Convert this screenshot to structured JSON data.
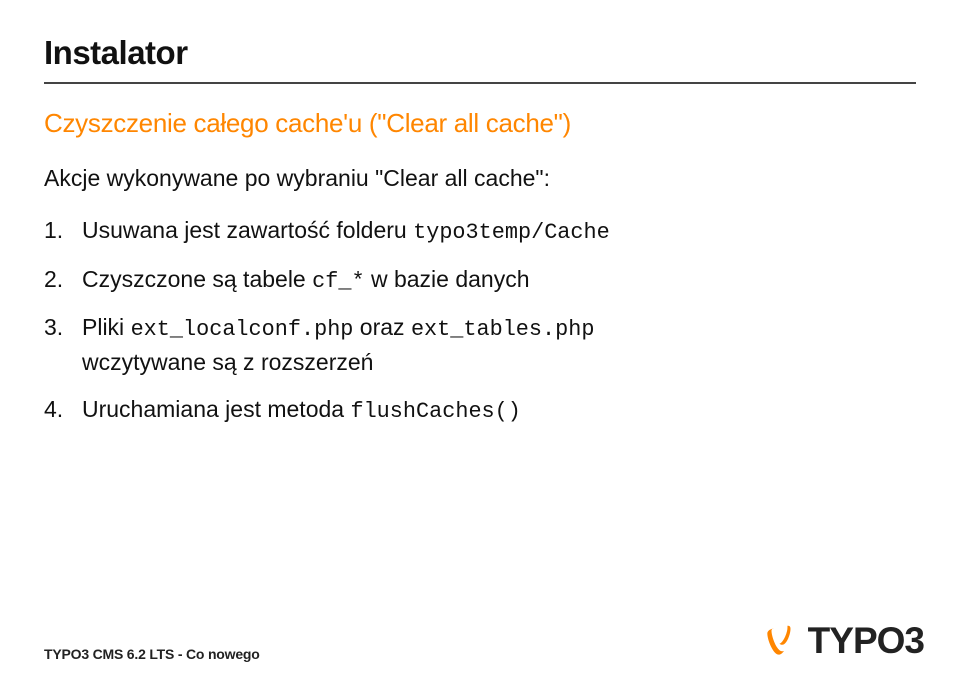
{
  "header": {
    "title": "Instalator"
  },
  "section": {
    "subtitle": "Czyszczenie całego cache'u (\"Clear all cache\")",
    "intro": "Akcje wykonywane po wybraniu \"Clear all cache\":",
    "steps": {
      "i1_a": "Usuwana jest zawartość folderu ",
      "i1_code": "typo3temp/Cache",
      "i2_a": "Czyszczone są tabele ",
      "i2_code": "cf_*",
      "i2_b": " w bazie danych",
      "i3_a": "Pliki ",
      "i3_code1": "ext_localconf.php",
      "i3_b": " oraz ",
      "i3_code2": "ext_tables.php",
      "i3_c": "wczytywane są z rozszerzeń",
      "i4_a": "Uruchamiana jest metoda ",
      "i4_code": "flushCaches()"
    }
  },
  "footer": {
    "text": "TYPO3 CMS 6.2 LTS - Co nowego",
    "brandText": "TYPO3"
  },
  "colors": {
    "accent": "#ff8600"
  }
}
